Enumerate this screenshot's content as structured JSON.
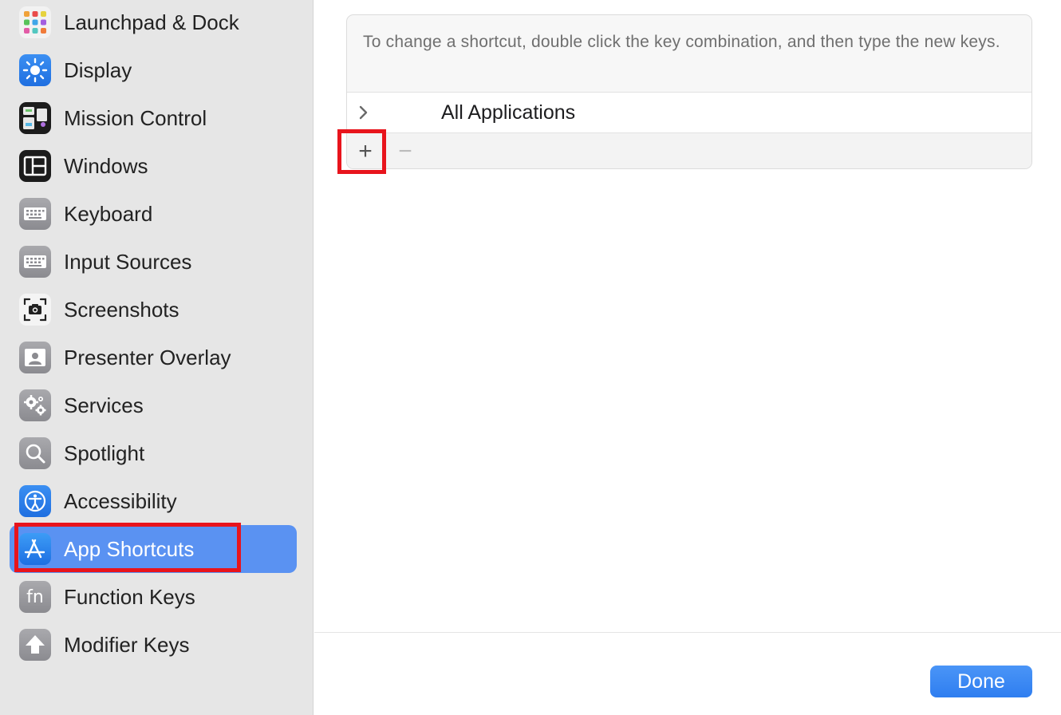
{
  "sidebar": {
    "items": [
      {
        "label": "Launchpad & Dock",
        "icon": "launchpad-dock-icon"
      },
      {
        "label": "Display",
        "icon": "display-brightness-icon"
      },
      {
        "label": "Mission Control",
        "icon": "mission-control-icon"
      },
      {
        "label": "Windows",
        "icon": "windows-icon"
      },
      {
        "label": "Keyboard",
        "icon": "keyboard-icon"
      },
      {
        "label": "Input Sources",
        "icon": "input-sources-keyboard-icon"
      },
      {
        "label": "Screenshots",
        "icon": "screenshot-camera-icon"
      },
      {
        "label": "Presenter Overlay",
        "icon": "presenter-overlay-icon"
      },
      {
        "label": "Services",
        "icon": "services-gears-icon"
      },
      {
        "label": "Spotlight",
        "icon": "spotlight-magnifier-icon"
      },
      {
        "label": "Accessibility",
        "icon": "accessibility-icon"
      },
      {
        "label": "App Shortcuts",
        "icon": "app-store-icon",
        "selected": true
      },
      {
        "label": "Function Keys",
        "icon": "fn-icon"
      },
      {
        "label": "Modifier Keys",
        "icon": "modifier-up-arrow-icon"
      }
    ],
    "fn_glyph": "fn"
  },
  "main": {
    "instructions": "To change a shortcut, double click the key combination, and then type the new keys.",
    "rows": [
      {
        "label": "All Applications"
      }
    ],
    "add_label": "+",
    "remove_label": "−"
  },
  "footer": {
    "done_label": "Done"
  },
  "colors": {
    "selected": "#5a92f2",
    "accent": "#2f7ef0",
    "highlight": "#e8141c"
  }
}
